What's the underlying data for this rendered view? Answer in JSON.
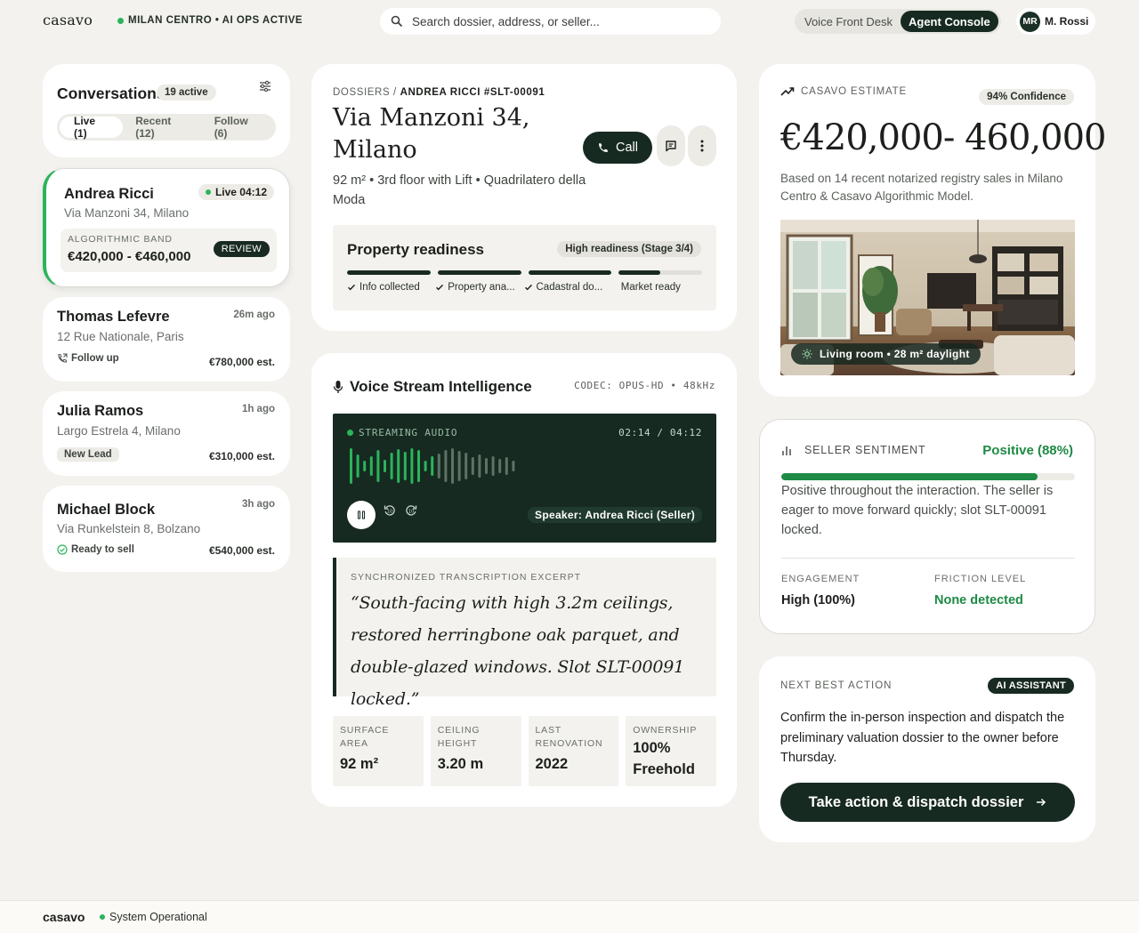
{
  "header": {
    "logo": "casavo",
    "status": "MILAN CENTRO • AI OPS ACTIVE",
    "search_placeholder": "Search dossier, address, or seller...",
    "modes": [
      "Voice Front Desk",
      "Agent Console"
    ],
    "active_mode": "Agent Console",
    "user_initials": "MR",
    "user_name": "M. Rossi"
  },
  "conversations": {
    "title": "Conversations",
    "count": "19 active",
    "tabs": [
      "Live (1)",
      "Recent (12)",
      "Follow (6)"
    ],
    "active": {
      "name": "Andrea Ricci",
      "address": "Via Manzoni 34, Milano",
      "status": "Live 04:12",
      "band_label": "ALGORITHMIC BAND",
      "band_value": "€420,000 - €460,000",
      "badge": "REVIEW"
    },
    "items": [
      {
        "name": "Thomas Lefevre",
        "address": "12 Rue Nationale, Paris",
        "time": "26m ago",
        "tag": "Follow up",
        "price": "€780,000 est."
      },
      {
        "name": "Julia Ramos",
        "address": "Largo Estrela 4, Milano",
        "time": "1h ago",
        "tag": "New Lead",
        "price": "€310,000 est."
      },
      {
        "name": "Michael Block",
        "address": "Via Runkelstein 8, Bolzano",
        "time": "3h ago",
        "tag": "Ready to sell",
        "price": "€540,000 est."
      }
    ]
  },
  "property": {
    "crumb_root": "DOSSIERS /",
    "crumb_current": "ANDREA RICCI #SLT-00091",
    "title": "Via Manzoni 34, Milano",
    "description": "92 m² • 3rd floor with Lift • Quadrilatero della Moda",
    "call_label": "Call",
    "readiness": {
      "title": "Property readiness",
      "status": "High readiness (Stage 3/4)",
      "steps": [
        {
          "label": "Info collected",
          "done": true,
          "fill": 1.0
        },
        {
          "label": "Property ana...",
          "done": true,
          "fill": 1.0
        },
        {
          "label": "Cadastral do...",
          "done": true,
          "fill": 1.0
        },
        {
          "label": "Market ready",
          "done": false,
          "fill": 0.5
        }
      ]
    }
  },
  "voice": {
    "title": "Voice Stream Intelligence",
    "codec": "CODEC: OPUS-HD • 48kHz",
    "stream_label": "STREAMING AUDIO",
    "time": "02:14 / 04:12",
    "progress": 0.53,
    "speaker": "Speaker: Andrea Ricci (Seller)",
    "excerpt_label": "SYNCHRONIZED TRANSCRIPTION EXCERPT",
    "excerpt": "“South-facing with high 3.2m ceilings, restored herringbone oak parquet, and double-glazed windows. Slot SLT-00091 locked.”",
    "stats": [
      {
        "label": "SURFACE AREA",
        "value": "92 m²"
      },
      {
        "label": "CEILING HEIGHT",
        "value": "3.20 m"
      },
      {
        "label": "LAST RENOVATION",
        "value": "2022"
      },
      {
        "label": "OWNERSHIP",
        "value": "100% Freehold"
      }
    ]
  },
  "estimate": {
    "label": "CASAVO ESTIMATE",
    "confidence": "94% Confidence",
    "value": "€420,000- 460,000",
    "description": "Based on 14 recent notarized registry sales in Milano Centro & Casavo Algorithmic Model.",
    "photo_caption": "Living room • 28 m² daylight"
  },
  "sentiment": {
    "label": "SELLER SENTIMENT",
    "value": "Positive (88%)",
    "level": 0.88,
    "description": "Positive throughout the interaction. The seller is eager to move forward quickly; slot SLT-00091 locked.",
    "engagement_label": "ENGAGEMENT",
    "engagement_value": "High (100%)",
    "friction_label": "FRICTION LEVEL",
    "friction_value": "None detected"
  },
  "next_action": {
    "label": "NEXT BEST ACTION",
    "badge": "AI ASSISTANT",
    "description": "Confirm the in-person inspection and dispatch the preliminary valuation dossier to the owner before Thursday.",
    "button": "Take action & dispatch dossier"
  },
  "footer": {
    "logo": "casavo",
    "status": "System Operational"
  },
  "colors": {
    "dark_green": "#162a21",
    "accent_green": "#2cb45a",
    "positive_green": "#1e8a45",
    "background": "#f3f2ee"
  }
}
